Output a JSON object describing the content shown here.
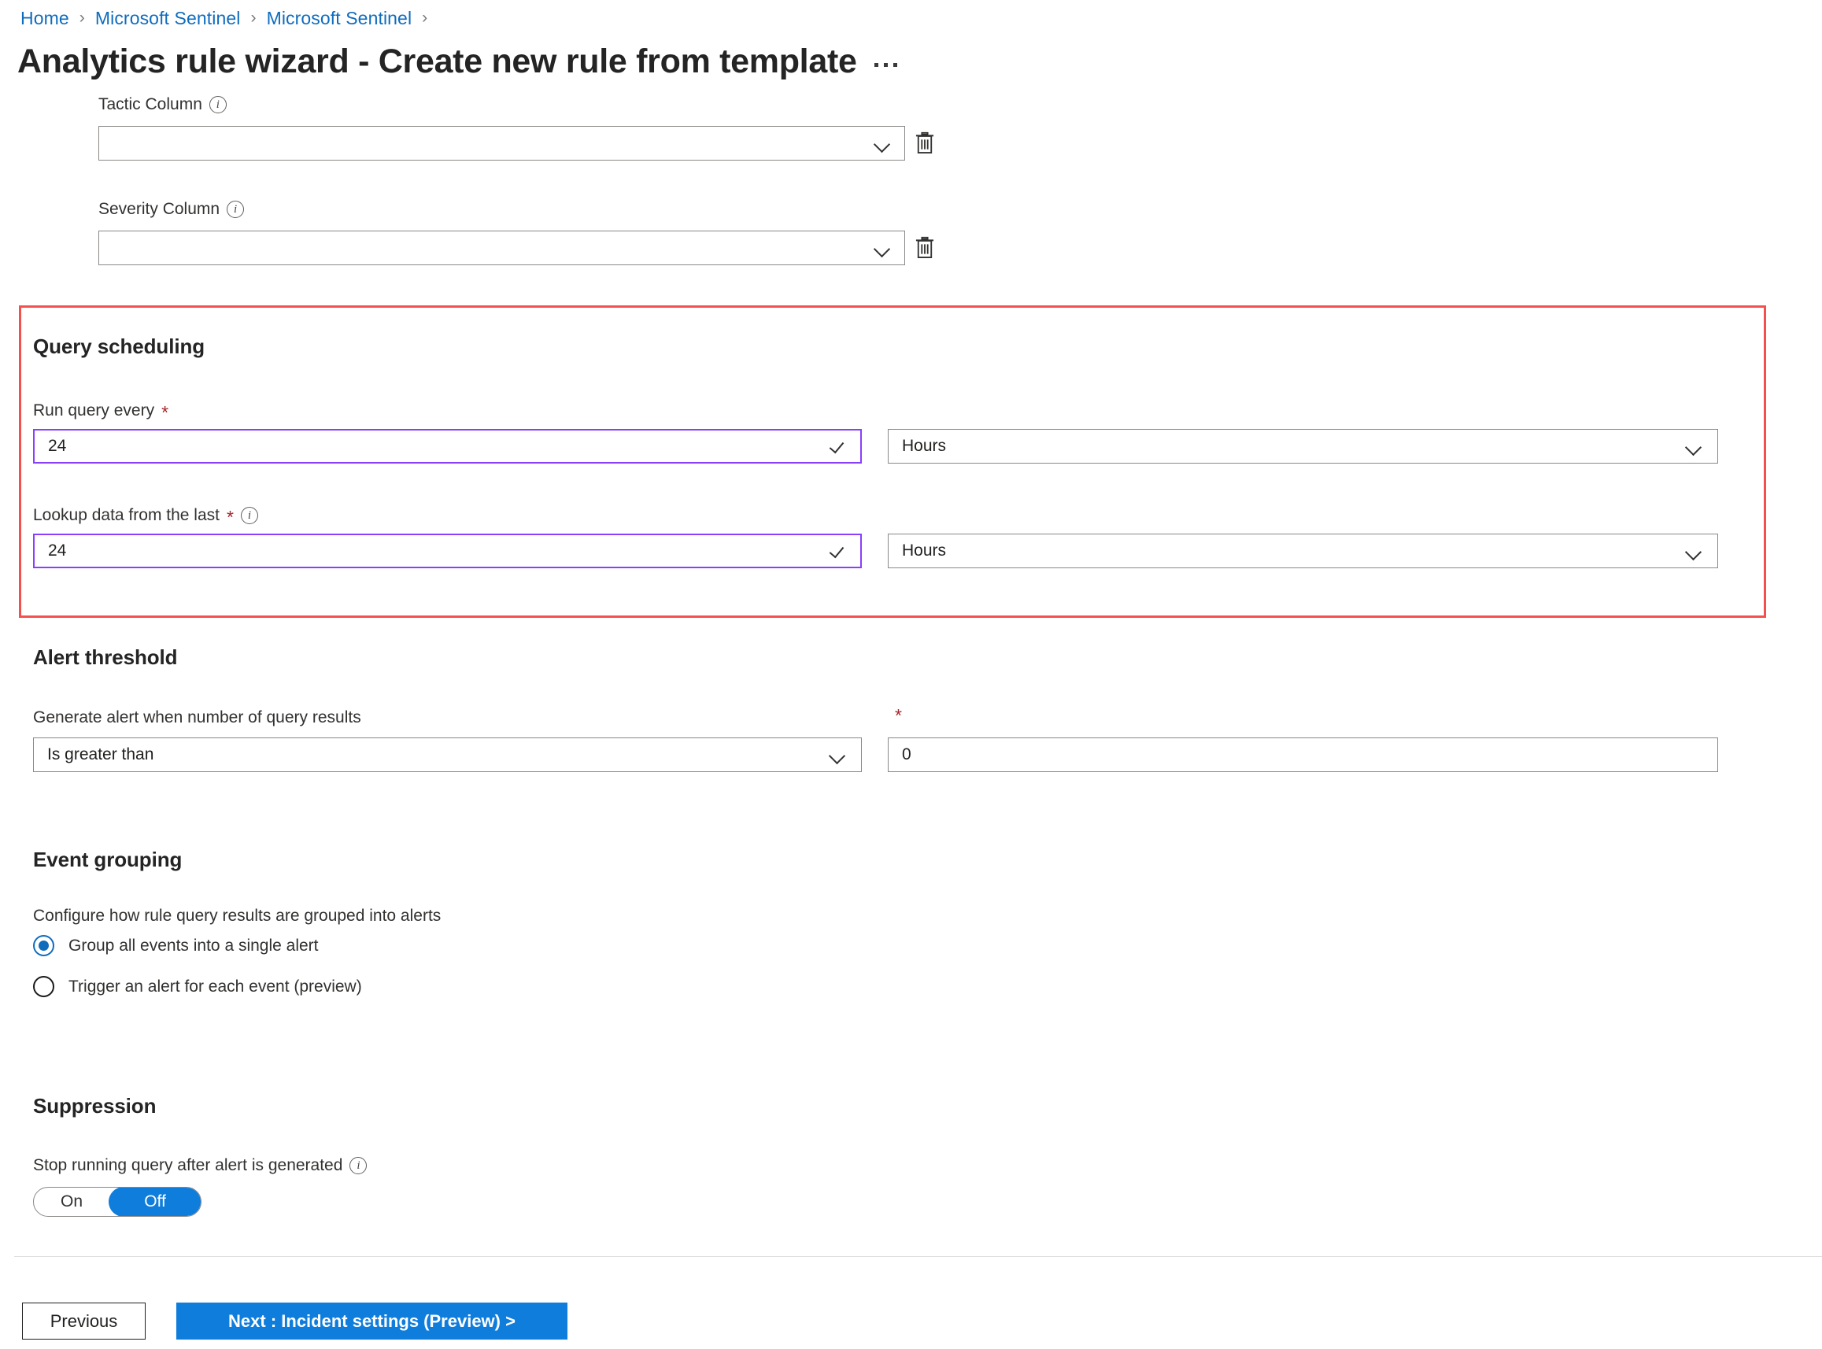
{
  "breadcrumb": {
    "items": [
      "Home",
      "Microsoft Sentinel",
      "Microsoft Sentinel"
    ],
    "separator": "›"
  },
  "header": {
    "title": "Analytics rule wizard - Create new rule from template",
    "more_actions": "···"
  },
  "top_fields": {
    "tactic": {
      "label": "Tactic Column",
      "info": "i",
      "value": "",
      "delete_icon": "trash-icon",
      "chevron": "chevron-down-icon"
    },
    "severity": {
      "label": "Severity Column",
      "info": "i",
      "value": "",
      "delete_icon": "trash-icon",
      "chevron": "chevron-down-icon"
    }
  },
  "query_scheduling": {
    "heading": "Query scheduling",
    "highlight_color": "#f4514e",
    "run_query_every": {
      "label": "Run query every",
      "required": "*",
      "value": "24",
      "unit": "Hours",
      "validation_icon": "check-icon"
    },
    "lookup_data": {
      "label": "Lookup data from the last",
      "required": "*",
      "info": "i",
      "value": "24",
      "unit": "Hours",
      "validation_icon": "check-icon"
    }
  },
  "alert_threshold": {
    "heading": "Alert threshold",
    "operator_label": "Generate alert when number of query results",
    "operator_value": "Is greater than",
    "threshold_required": "*",
    "threshold_value": "0"
  },
  "event_grouping": {
    "heading": "Event grouping",
    "description": "Configure how rule query results are grouped into alerts",
    "options": [
      {
        "label": "Group all events into a single alert",
        "selected": true
      },
      {
        "label": "Trigger an alert for each event (preview)",
        "selected": false
      }
    ]
  },
  "suppression": {
    "heading": "Suppression",
    "toggle_label": "Stop running query after alert is generated",
    "info": "i",
    "on_label": "On",
    "off_label": "Off",
    "state": "Off"
  },
  "footer": {
    "previous_label": "Previous",
    "next_label": "Next : Incident settings (Preview) >"
  },
  "colors": {
    "link": "#0f6cbd",
    "primary_button": "#0f7ddb",
    "required_star": "#a4262c",
    "highlight_border": "#f4514e",
    "focused_input_border": "#8a3ffc"
  }
}
